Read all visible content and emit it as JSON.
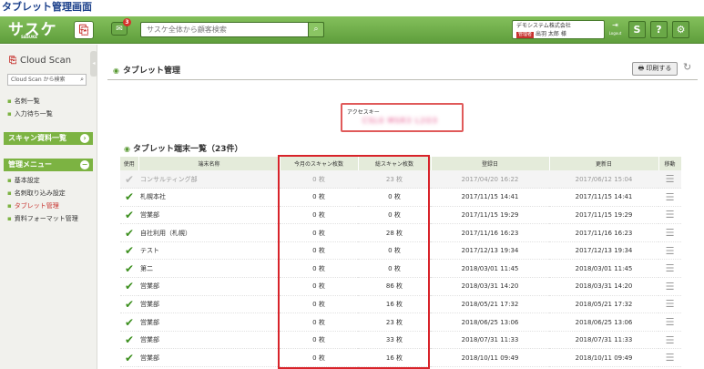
{
  "caption": "タブレット管理画面",
  "header": {
    "logo": "サスケ",
    "logo_sub": "SASUKE",
    "notif_count": "3",
    "search_placeholder": "サスケ全体から顧客検索",
    "company": "デモシステム株式会社",
    "admin_tag": "管理者",
    "user_name": "出羽 太郎 様",
    "logout_label": "Logout",
    "btn_s": "S",
    "btn_help": "?",
    "btn_settings": "⚙"
  },
  "sidebar": {
    "title": "Cloud Scan",
    "search_placeholder": "Cloud Scan から検索",
    "links_top": [
      "名刺一覧",
      "入力待ち一覧"
    ],
    "scan_section": "スキャン資料一覧",
    "admin_section": "管理メニュー",
    "admin_links": [
      "基本設定",
      "名刺取り込み設定",
      "タブレット管理",
      "資料フォーマット管理"
    ]
  },
  "main": {
    "title": "タブレット管理",
    "print_label": "印刷する",
    "access_label": "アクセスキー",
    "access_key": "CSL0 MSR3 L2O3",
    "list_title": "タブレット端末一覧（23件）",
    "columns": [
      "使用",
      "端末名称",
      "今月のスキャン枚数",
      "総スキャン枚数",
      "登録日",
      "更新日",
      "移動"
    ],
    "rows": [
      {
        "name": "コンサルティング部",
        "month": "0 枚",
        "total": "23 枚",
        "reg": "2017/04/20 16:22",
        "upd": "2017/06/12 15:04",
        "active": false
      },
      {
        "name": "札幌本社",
        "month": "0 枚",
        "total": "0 枚",
        "reg": "2017/11/15 14:41",
        "upd": "2017/11/15 14:41",
        "active": true
      },
      {
        "name": "営業部",
        "month": "0 枚",
        "total": "0 枚",
        "reg": "2017/11/15 19:29",
        "upd": "2017/11/15 19:29",
        "active": true
      },
      {
        "name": "自社利用（札幌）",
        "month": "0 枚",
        "total": "28 枚",
        "reg": "2017/11/16 16:23",
        "upd": "2017/11/16 16:23",
        "active": true
      },
      {
        "name": "テスト",
        "month": "0 枚",
        "total": "0 枚",
        "reg": "2017/12/13 19:34",
        "upd": "2017/12/13 19:34",
        "active": true
      },
      {
        "name": "第二",
        "month": "0 枚",
        "total": "0 枚",
        "reg": "2018/03/01 11:45",
        "upd": "2018/03/01 11:45",
        "active": true
      },
      {
        "name": "営業部",
        "month": "0 枚",
        "total": "86 枚",
        "reg": "2018/03/31 14:20",
        "upd": "2018/03/31 14:20",
        "active": true
      },
      {
        "name": "営業部",
        "month": "0 枚",
        "total": "16 枚",
        "reg": "2018/05/21 17:32",
        "upd": "2018/05/21 17:32",
        "active": true
      },
      {
        "name": "営業部",
        "month": "0 枚",
        "total": "23 枚",
        "reg": "2018/06/25 13:06",
        "upd": "2018/06/25 13:06",
        "active": true
      },
      {
        "name": "営業部",
        "month": "0 枚",
        "total": "33 枚",
        "reg": "2018/07/31 11:33",
        "upd": "2018/07/31 11:33",
        "active": true
      },
      {
        "name": "営業部",
        "month": "0 枚",
        "total": "16 枚",
        "reg": "2018/10/11 09:49",
        "upd": "2018/10/11 09:49",
        "active": true
      }
    ]
  },
  "colors": {
    "header_green": "#6aa847",
    "highlight_red": "#d8232a"
  }
}
